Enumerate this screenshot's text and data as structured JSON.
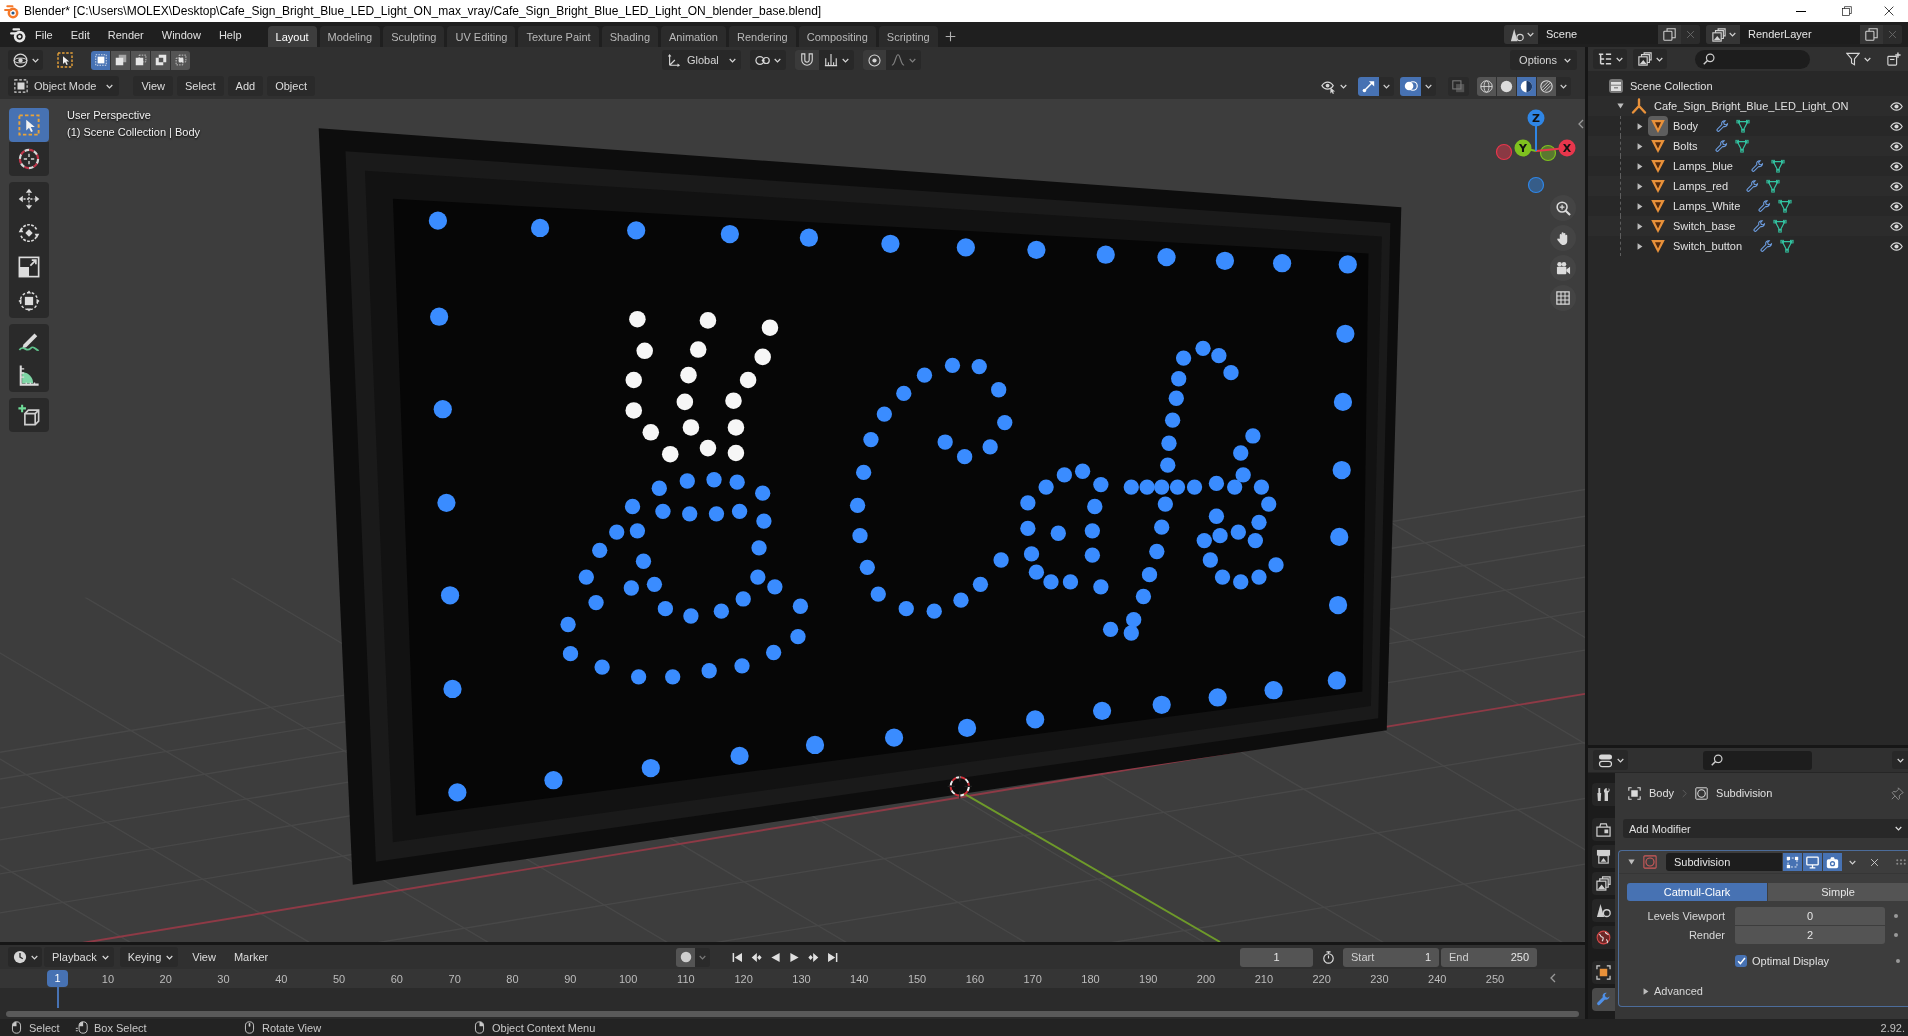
{
  "window": {
    "title": "Blender* [C:\\Users\\MOLEX\\Desktop\\Cafe_Sign_Bright_Blue_LED_Light_ON_max_vray/Cafe_Sign_Bright_Blue_LED_Light_ON_blender_base.blend]"
  },
  "menu": [
    "File",
    "Edit",
    "Render",
    "Window",
    "Help"
  ],
  "workspaces": [
    {
      "label": "Layout",
      "selected": true
    },
    {
      "label": "Modeling",
      "selected": false
    },
    {
      "label": "Sculpting",
      "selected": false
    },
    {
      "label": "UV Editing",
      "selected": false
    },
    {
      "label": "Texture Paint",
      "selected": false
    },
    {
      "label": "Shading",
      "selected": false
    },
    {
      "label": "Animation",
      "selected": false
    },
    {
      "label": "Rendering",
      "selected": false
    },
    {
      "label": "Compositing",
      "selected": false
    },
    {
      "label": "Scripting",
      "selected": false
    }
  ],
  "scene": {
    "scene_name": "Scene",
    "view_layer": "RenderLayer"
  },
  "tool_settings": {
    "selection_modes": [
      {
        "kind": "set",
        "selected": true
      },
      {
        "kind": "extend",
        "selected": false
      },
      {
        "kind": "subtract",
        "selected": false
      },
      {
        "kind": "difference",
        "selected": false
      },
      {
        "kind": "intersect",
        "selected": false
      }
    ],
    "orientation": "Global",
    "options": "Options"
  },
  "viewport": {
    "mode": "Object Mode",
    "menus": [
      "View",
      "Select",
      "Add",
      "Object"
    ],
    "gizmos_on": true,
    "overlays_on": true,
    "xray_on": false,
    "shading": [
      {
        "kind": "wireframe",
        "selected": false
      },
      {
        "kind": "solid",
        "selected": false
      },
      {
        "kind": "material",
        "selected": true
      },
      {
        "kind": "rendered",
        "selected": false
      }
    ],
    "info": [
      "User Perspective",
      "(1) Scene Collection | Body"
    ],
    "tool_groups": [
      {
        "tools": [
          {
            "kind": "select_box",
            "selected": true
          },
          {
            "kind": "cursor",
            "selected": false
          }
        ]
      },
      {
        "tools": [
          {
            "kind": "move",
            "selected": false
          },
          {
            "kind": "rotate",
            "selected": false
          },
          {
            "kind": "scale",
            "selected": false
          },
          {
            "kind": "transform",
            "selected": false
          }
        ]
      },
      {
        "tools": [
          {
            "kind": "annotate",
            "selected": false
          },
          {
            "kind": "measure",
            "selected": false
          }
        ]
      },
      {
        "tools": [
          {
            "kind": "add_cube",
            "selected": false
          }
        ]
      }
    ],
    "axes": [
      {
        "label": "X",
        "color": "#e8364c"
      },
      {
        "label": "Y",
        "color": "#7fc21f"
      },
      {
        "label": "Z",
        "color": "#2f86e6"
      }
    ]
  },
  "outliner": {
    "root": "Scene Collection",
    "tree": [
      {
        "name": "Cafe_Sign_Bright_Blue_LED_Light_ON",
        "kind": "empty",
        "active": false,
        "expanded": true,
        "visible": true,
        "children": [
          {
            "name": "Body",
            "kind": "mesh",
            "active": true,
            "expanded": false,
            "visible": true
          },
          {
            "name": "Bolts",
            "kind": "mesh",
            "active": false,
            "expanded": false,
            "visible": true
          },
          {
            "name": "Lamps_blue",
            "kind": "mesh",
            "active": false,
            "expanded": false,
            "visible": true
          },
          {
            "name": "Lamps_red",
            "kind": "mesh",
            "active": false,
            "expanded": false,
            "visible": true
          },
          {
            "name": "Lamps_White",
            "kind": "mesh",
            "active": false,
            "expanded": false,
            "visible": true
          },
          {
            "name": "Switch_base",
            "kind": "mesh",
            "active": false,
            "expanded": false,
            "visible": true
          },
          {
            "name": "Switch_button",
            "kind": "mesh",
            "active": false,
            "expanded": false,
            "visible": true
          }
        ]
      }
    ]
  },
  "properties": {
    "tabs": [
      {
        "kind": "tool",
        "selected": false
      },
      {
        "kind": "render",
        "selected": false
      },
      {
        "kind": "output",
        "selected": false
      },
      {
        "kind": "view_layer",
        "selected": false
      },
      {
        "kind": "scene",
        "selected": false
      },
      {
        "kind": "world",
        "selected": false
      },
      {
        "kind": "object",
        "selected": false
      },
      {
        "kind": "modifiers",
        "selected": true
      }
    ],
    "breadcrumb": [
      "Body",
      "Subdivision"
    ],
    "add_modifier": "Add Modifier",
    "modifier": {
      "name": "Subdivision",
      "expanded": true,
      "edit_mode": true,
      "viewport": true,
      "render": true,
      "algorithms": [
        {
          "label": "Catmull-Clark",
          "selected": true
        },
        {
          "label": "Simple",
          "selected": false
        }
      ],
      "fields": [
        {
          "label": "Levels Viewport",
          "value": "0"
        },
        {
          "label": "Render",
          "value": "2"
        }
      ],
      "optimal_display": {
        "label": "Optimal Display",
        "checked": true
      },
      "subpanels": [
        {
          "label": "Advanced",
          "expanded": false
        }
      ]
    }
  },
  "timeline": {
    "menus": [
      {
        "label": "Playback",
        "dropdown": true
      },
      {
        "label": "Keying",
        "dropdown": true
      },
      {
        "label": "View",
        "dropdown": false
      },
      {
        "label": "Marker",
        "dropdown": false
      }
    ],
    "auto_keying": false,
    "current_frame": "1",
    "start": {
      "label": "Start",
      "value": "1"
    },
    "end": {
      "label": "End",
      "value": "250"
    },
    "playhead": "1",
    "ruler": [
      "10",
      "20",
      "30",
      "40",
      "50",
      "60",
      "70",
      "80",
      "90",
      "100",
      "110",
      "120",
      "130",
      "140",
      "150",
      "160",
      "170",
      "180",
      "190",
      "200",
      "210",
      "220",
      "230",
      "240",
      "250"
    ]
  },
  "status_bar": {
    "hints": [
      {
        "kind": "left_click",
        "label": "Select"
      },
      {
        "kind": "left_drag",
        "label": "Box Select"
      },
      {
        "kind": "middle_drag",
        "label": "Rotate View"
      },
      {
        "kind": "right_click",
        "label": "Object Context Menu"
      }
    ],
    "version": "2.92."
  }
}
